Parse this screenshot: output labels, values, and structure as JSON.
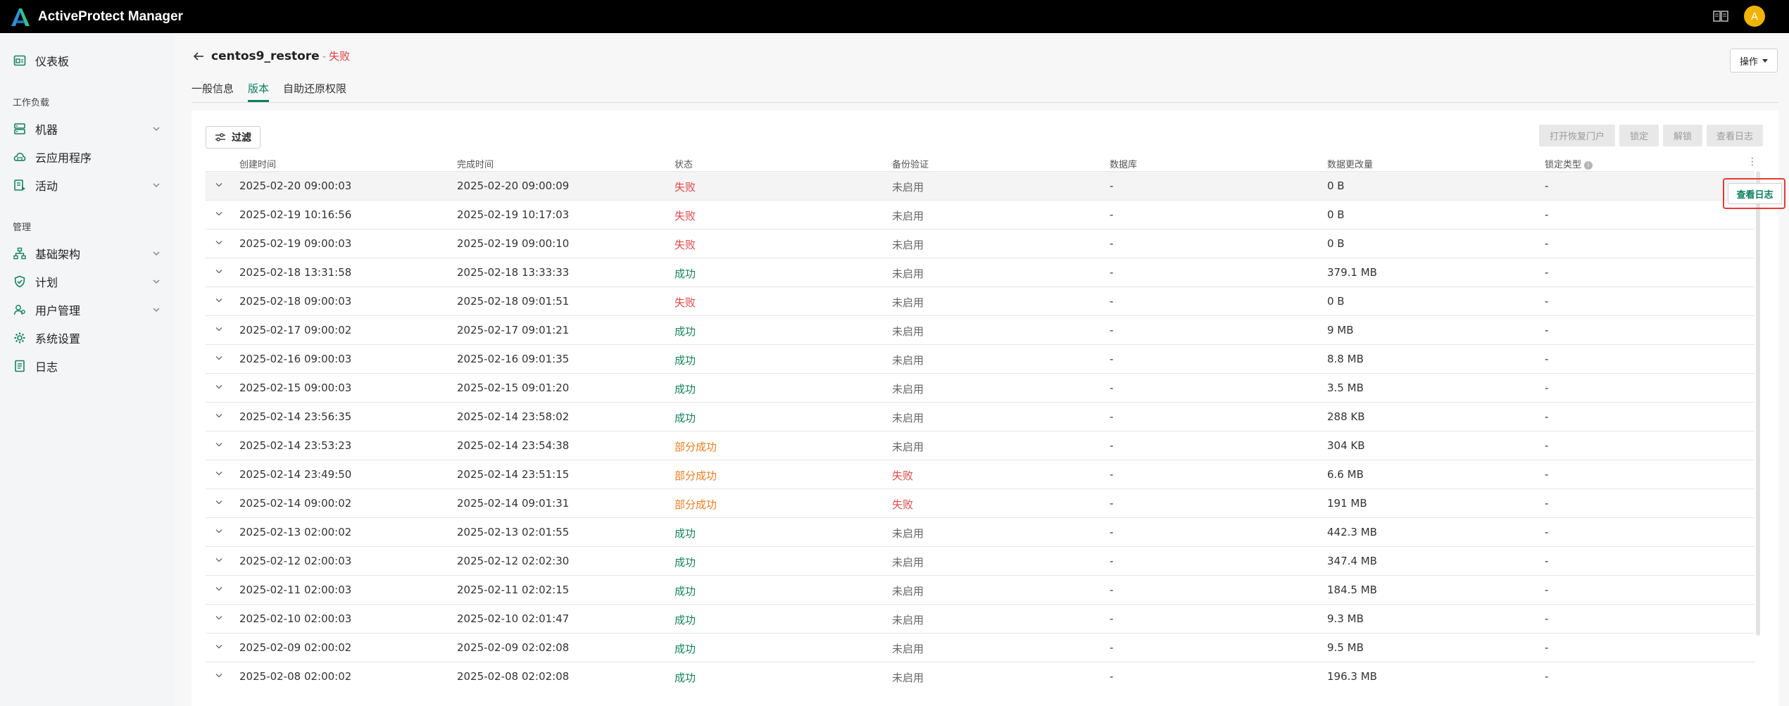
{
  "app": {
    "title": "ActiveProtect Manager",
    "avatar_letter": "A"
  },
  "sidebar": {
    "dashboard": "仪表板",
    "section_workloads": "工作负载",
    "machines": "机器",
    "cloud_apps": "云应用程序",
    "activity": "活动",
    "section_manage": "管理",
    "infrastructure": "基础架构",
    "plans": "计划",
    "user_mgmt": "用户管理",
    "system_settings": "系统设置",
    "logs": "日志"
  },
  "header": {
    "title": "centos9_restore",
    "separator": "-",
    "status": "失败",
    "ops_label": "操作"
  },
  "tabs": [
    {
      "label": "一般信息"
    },
    {
      "label": "版本"
    },
    {
      "label": "自助还原权限"
    }
  ],
  "toolbar": {
    "filter_label": "过滤",
    "open_portal": "打开恢复门户",
    "lock": "锁定",
    "unlock": "解锁",
    "view_log": "查看日志"
  },
  "columns": {
    "created": "创建时间",
    "completed": "完成时间",
    "status": "状态",
    "backup_verify": "备份验证",
    "database": "数据库",
    "data_change": "数据更改量",
    "lock_type": "锁定类型"
  },
  "row_action_label": "查看日志",
  "rows": [
    {
      "created": "2025-02-20 09:00:03",
      "completed": "2025-02-20 09:00:09",
      "status": "失败",
      "status_kind": "fail",
      "verify": "未启用",
      "verify_kind": "off",
      "db": "-",
      "change": "0 B",
      "lock": "-"
    },
    {
      "created": "2025-02-19 10:16:56",
      "completed": "2025-02-19 10:17:03",
      "status": "失败",
      "status_kind": "fail",
      "verify": "未启用",
      "verify_kind": "off",
      "db": "-",
      "change": "0 B",
      "lock": "-"
    },
    {
      "created": "2025-02-19 09:00:03",
      "completed": "2025-02-19 09:00:10",
      "status": "失败",
      "status_kind": "fail",
      "verify": "未启用",
      "verify_kind": "off",
      "db": "-",
      "change": "0 B",
      "lock": "-"
    },
    {
      "created": "2025-02-18 13:31:58",
      "completed": "2025-02-18 13:33:33",
      "status": "成功",
      "status_kind": "ok",
      "verify": "未启用",
      "verify_kind": "off",
      "db": "-",
      "change": "379.1 MB",
      "lock": "-"
    },
    {
      "created": "2025-02-18 09:00:03",
      "completed": "2025-02-18 09:01:51",
      "status": "失败",
      "status_kind": "fail",
      "verify": "未启用",
      "verify_kind": "off",
      "db": "-",
      "change": "0 B",
      "lock": "-"
    },
    {
      "created": "2025-02-17 09:00:02",
      "completed": "2025-02-17 09:01:21",
      "status": "成功",
      "status_kind": "ok",
      "verify": "未启用",
      "verify_kind": "off",
      "db": "-",
      "change": "9 MB",
      "lock": "-"
    },
    {
      "created": "2025-02-16 09:00:03",
      "completed": "2025-02-16 09:01:35",
      "status": "成功",
      "status_kind": "ok",
      "verify": "未启用",
      "verify_kind": "off",
      "db": "-",
      "change": "8.8 MB",
      "lock": "-"
    },
    {
      "created": "2025-02-15 09:00:03",
      "completed": "2025-02-15 09:01:20",
      "status": "成功",
      "status_kind": "ok",
      "verify": "未启用",
      "verify_kind": "off",
      "db": "-",
      "change": "3.5 MB",
      "lock": "-"
    },
    {
      "created": "2025-02-14 23:56:35",
      "completed": "2025-02-14 23:58:02",
      "status": "成功",
      "status_kind": "ok",
      "verify": "未启用",
      "verify_kind": "off",
      "db": "-",
      "change": "288 KB",
      "lock": "-"
    },
    {
      "created": "2025-02-14 23:53:23",
      "completed": "2025-02-14 23:54:38",
      "status": "部分成功",
      "status_kind": "partial",
      "verify": "未启用",
      "verify_kind": "off",
      "db": "-",
      "change": "304 KB",
      "lock": "-"
    },
    {
      "created": "2025-02-14 23:49:50",
      "completed": "2025-02-14 23:51:15",
      "status": "部分成功",
      "status_kind": "partial",
      "verify": "失败",
      "verify_kind": "fail",
      "db": "-",
      "change": "6.6 MB",
      "lock": "-"
    },
    {
      "created": "2025-02-14 09:00:02",
      "completed": "2025-02-14 09:01:31",
      "status": "部分成功",
      "status_kind": "partial",
      "verify": "失败",
      "verify_kind": "fail",
      "db": "-",
      "change": "191 MB",
      "lock": "-"
    },
    {
      "created": "2025-02-13 02:00:02",
      "completed": "2025-02-13 02:01:55",
      "status": "成功",
      "status_kind": "ok",
      "verify": "未启用",
      "verify_kind": "off",
      "db": "-",
      "change": "442.3 MB",
      "lock": "-"
    },
    {
      "created": "2025-02-12 02:00:03",
      "completed": "2025-02-12 02:02:30",
      "status": "成功",
      "status_kind": "ok",
      "verify": "未启用",
      "verify_kind": "off",
      "db": "-",
      "change": "347.4 MB",
      "lock": "-"
    },
    {
      "created": "2025-02-11 02:00:03",
      "completed": "2025-02-11 02:02:15",
      "status": "成功",
      "status_kind": "ok",
      "verify": "未启用",
      "verify_kind": "off",
      "db": "-",
      "change": "184.5 MB",
      "lock": "-"
    },
    {
      "created": "2025-02-10 02:00:03",
      "completed": "2025-02-10 02:01:47",
      "status": "成功",
      "status_kind": "ok",
      "verify": "未启用",
      "verify_kind": "off",
      "db": "-",
      "change": "9.3 MB",
      "lock": "-"
    },
    {
      "created": "2025-02-09 02:00:02",
      "completed": "2025-02-09 02:02:08",
      "status": "成功",
      "status_kind": "ok",
      "verify": "未启用",
      "verify_kind": "off",
      "db": "-",
      "change": "9.5 MB",
      "lock": "-"
    },
    {
      "created": "2025-02-08 02:00:02",
      "completed": "2025-02-08 02:02:08",
      "status": "成功",
      "status_kind": "ok",
      "verify": "未启用",
      "verify_kind": "off",
      "db": "-",
      "change": "196.3 MB",
      "lock": "-"
    }
  ],
  "colors": {
    "accent": "#0a7f5a",
    "fail": "#e04848",
    "partial": "#ee7d22",
    "highlight": "#e53935"
  },
  "icons": {
    "logo": "logo-icon",
    "docs": "book-icon",
    "dashboard": "dashboard-icon",
    "machines": "server-icon",
    "cloud": "cloud-icon",
    "activity": "activity-icon",
    "infrastructure": "hierarchy-icon",
    "plans": "shield-icon",
    "users": "users-icon",
    "settings": "gear-icon",
    "logs": "log-icon"
  }
}
